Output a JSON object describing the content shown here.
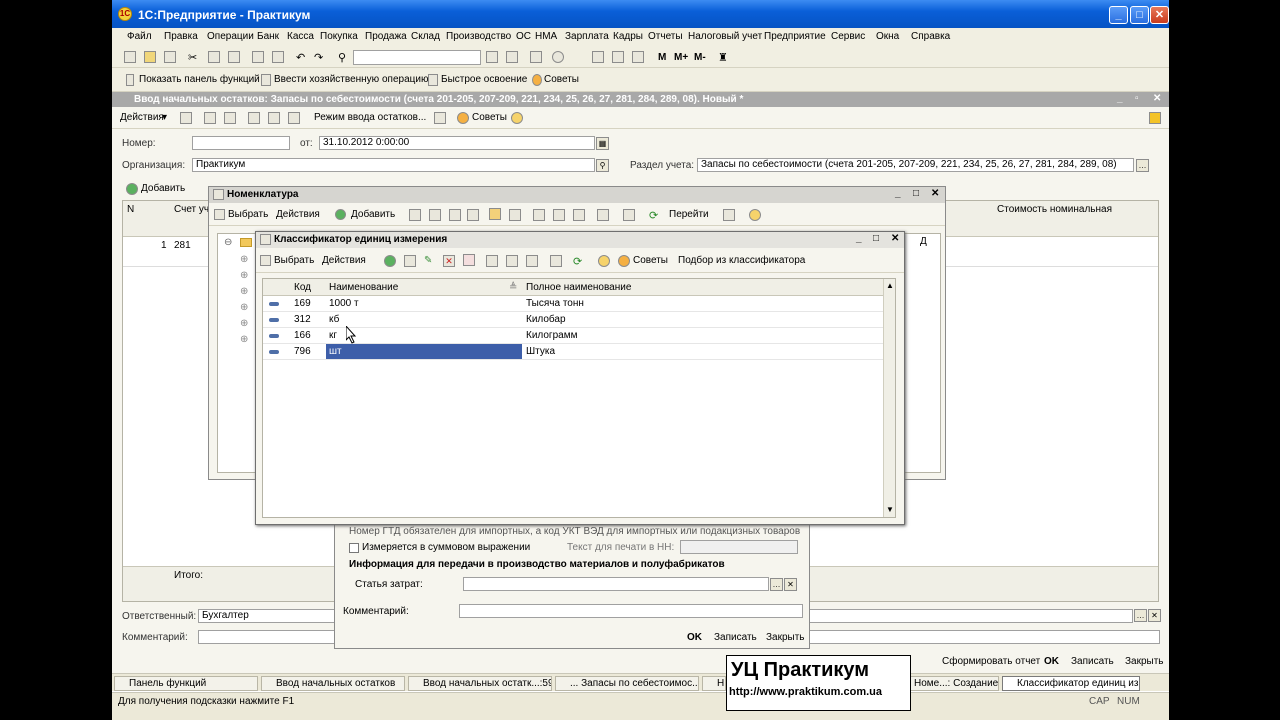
{
  "app": {
    "title": "1С:Предприятие - Практикум",
    "icon": "1c-logo-icon"
  },
  "menu": [
    "Файл",
    "Правка",
    "Операции",
    "Банк",
    "Касса",
    "Покупка",
    "Продажа",
    "Склад",
    "Производство",
    "ОС",
    "НМА",
    "Зарплата",
    "Кадры",
    "Отчеты",
    "Налоговый учет",
    "Предприятие",
    "Сервис",
    "Окна",
    "Справка"
  ],
  "toolbar2": {
    "panel": "Показать панель функций",
    "enter": "Ввести хозяйственную операцию",
    "learn": "Быстрое освоение",
    "tips": "Советы"
  },
  "toolbar1": {
    "marks": [
      "M",
      "M+",
      "M-"
    ]
  },
  "doc": {
    "title": "Ввод начальных остатков: Запасы по себестоимости (счета 201-205, 207-209, 221, 234, 25, 26, 27, 281, 284, 289, 08). Новый *",
    "actions": "Действия",
    "mode": "Режим ввода остатков...",
    "tips": "Советы",
    "number_label": "Номер:",
    "number_value": "",
    "from_label": "от:",
    "date": "31.10.2012  0:00:00",
    "org_label": "Организация:",
    "org": "Практикум",
    "section_label": "Раздел учета:",
    "section": "Запасы по себестоимости (счета 201-205, 207-209, 221, 234, 25, 26, 27, 281, 284, 289, 08)",
    "add": "Добавить",
    "col_n": "N",
    "col_acc": "Счет уче",
    "col_nominal": "Стоимость номинальная",
    "row_n": "1",
    "row_acc": "281",
    "total": "Итого:",
    "resp_label": "Ответственный:",
    "resp": "Бухгалтер",
    "comment_label": "Комментарий:",
    "comment": "",
    "btn_form": "Сформировать отчет",
    "btn_ok": "OK",
    "btn_save": "Записать",
    "btn_close": "Закрыть"
  },
  "nomen": {
    "title": "Номенклатура",
    "select": "Выбрать",
    "actions": "Действия",
    "add": "Добавить",
    "goto": "Перейти",
    "col_d": "Д"
  },
  "card": {
    "gtd_note": "Номер ГТД обязателен для импортных, а код УКТ ВЭД для импортных или подакцизных товаров",
    "sum_check": "Измеряется в суммовом выражении",
    "print_label": "Текст для печати в НН:",
    "print_value": "",
    "info_title": "Информация для передачи в производство материалов и полуфабрикатов",
    "cost_label": "Статья затрат:",
    "cost_value": "",
    "comment_label": "Комментарий:",
    "comment": "",
    "ok": "OK",
    "save": "Записать",
    "close": "Закрыть"
  },
  "classif": {
    "title": "Классификатор единиц измерения",
    "select": "Выбрать",
    "actions": "Действия",
    "tips": "Советы",
    "pick": "Подбор из классификатора",
    "col_code": "Код",
    "col_name": "Наименование",
    "col_full": "Полное наименование",
    "rows": [
      {
        "code": "169",
        "name": "1000 т",
        "full": "Тысяча тонн"
      },
      {
        "code": "312",
        "name": "кб",
        "full": "Килобар"
      },
      {
        "code": "166",
        "name": "кг",
        "full": "Килограмм"
      },
      {
        "code": "796",
        "name": "шт",
        "full": "Штука"
      }
    ],
    "selected_row": 3
  },
  "taskbar": [
    "Панель функций",
    "Ввод начальных остатков",
    "Ввод начальных остатк...:59",
    "... Запасы по себестоимос...",
    "Н",
    "Номе...: Создание *",
    "Классификатор единиц из..."
  ],
  "status": {
    "hint": "Для получения подсказки нажмите F1",
    "cap": "CAP",
    "num": "NUM"
  },
  "watermark": {
    "line1": "УЦ Практикум",
    "line2": "http://www.praktikum.com.ua"
  },
  "colors": {
    "title_blue": "#0a5fd8",
    "selection": "#3d5ea9"
  }
}
